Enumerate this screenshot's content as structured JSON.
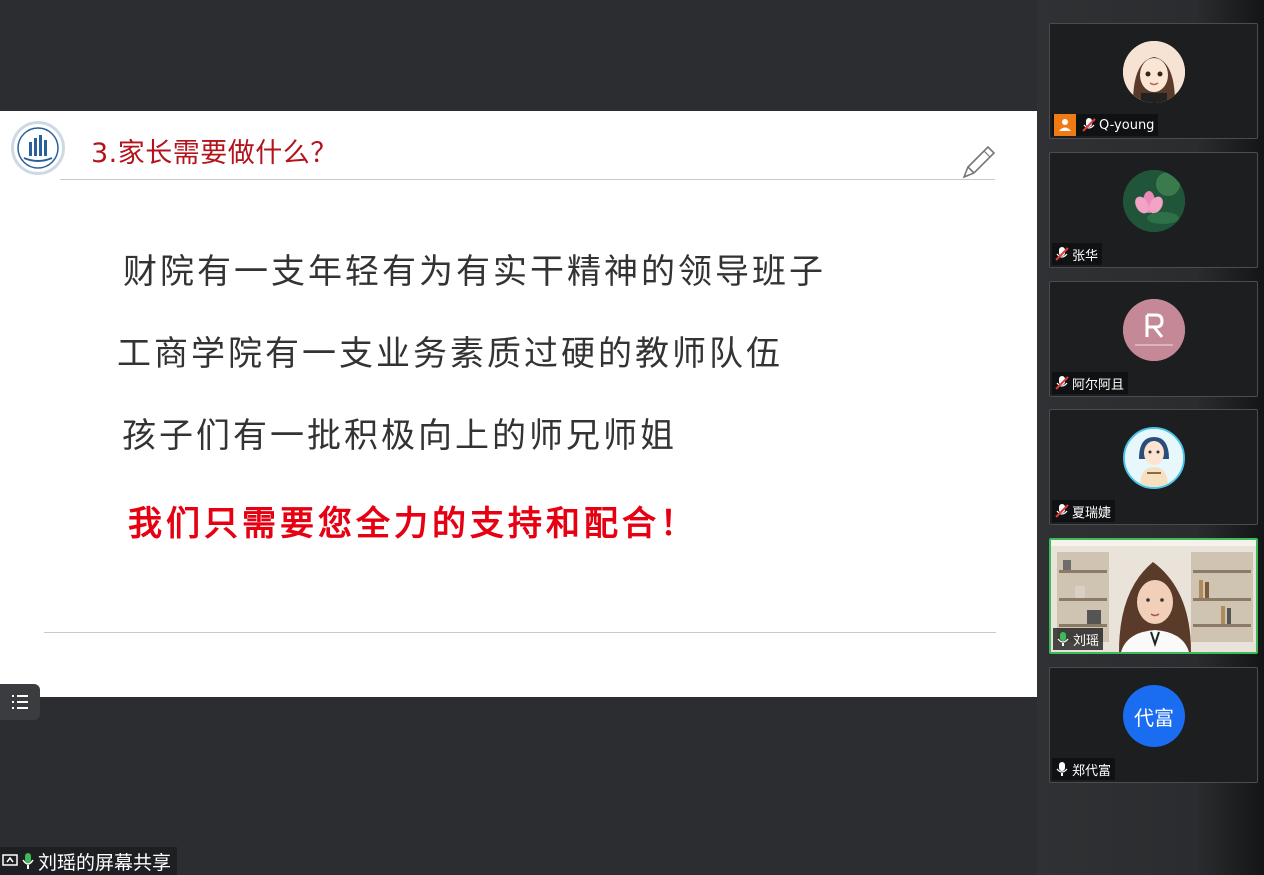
{
  "slide": {
    "title": "3.家长需要做什么？",
    "lines": [
      "财院有一支年轻有为有实干精神的领导班子",
      "工商学院有一支业务素质过硬的教师队伍",
      "孩子们有一批积极向上的师兄师姐"
    ],
    "highlight": "我们只需要您全力的支持和配合！"
  },
  "screen_share": {
    "label": "刘瑶的屏幕共享"
  },
  "participants": [
    {
      "name": "Q-young",
      "mic": "muted",
      "host": true,
      "avatar": "cartoon-girl-avatar"
    },
    {
      "name": "张华",
      "mic": "muted",
      "avatar": "lotus-flower-avatar"
    },
    {
      "name": "阿尔阿且",
      "mic": "muted",
      "avatar": "letter-r-avatar"
    },
    {
      "name": "夏瑞婕",
      "mic": "muted",
      "avatar": "cartoon-woman-avatar"
    },
    {
      "name": "刘瑶",
      "mic": "active",
      "avatar": "video-feed"
    },
    {
      "name": "郑代富",
      "mic": "unmuted",
      "avatar": "initials-avatar",
      "initials": "代富"
    }
  ],
  "colors": {
    "title_red": "#b3141c",
    "highlight_red": "#e60012",
    "speaking_green": "#3dbb5a",
    "initials_blue": "#1a6df0"
  }
}
